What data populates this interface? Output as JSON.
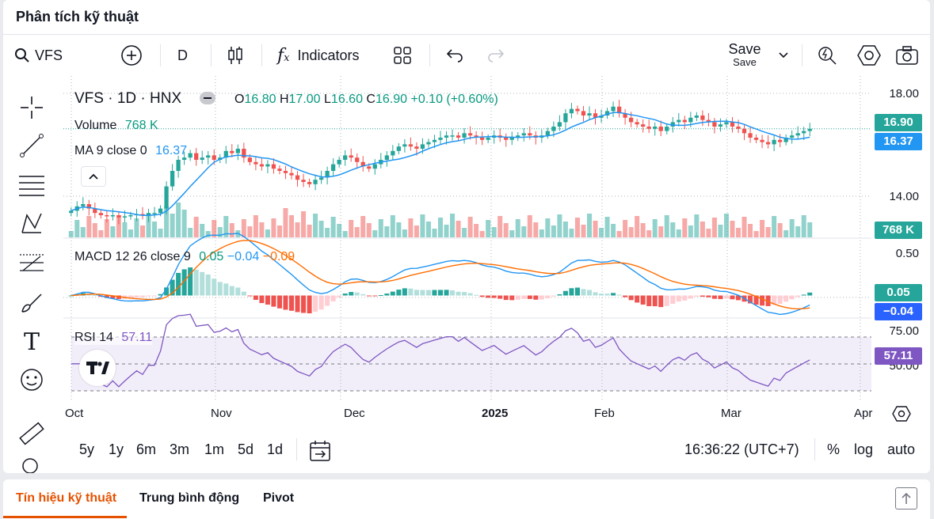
{
  "header": {
    "title": "Phân tích kỹ thuật"
  },
  "toolbar": {
    "symbol": "VFS",
    "interval": "D",
    "indicators_label": "Indicators",
    "save_label": "Save",
    "save_sub_label": "Save"
  },
  "legend": {
    "symbol_line": "VFS · 1D · HNX",
    "open_prefix": "O",
    "open": "16.80",
    "high_prefix": "H",
    "high": "17.00",
    "low_prefix": "L",
    "low": "16.60",
    "close_prefix": "C",
    "close": "16.90",
    "change": "+0.10 (+0.60%)",
    "volume_label": "Volume",
    "volume_value": "768 K",
    "ma_label": "MA 9 close 0",
    "ma_value": "16.37",
    "macd_label": "MACD 12 26 close 9",
    "macd_value1": "0.05",
    "macd_value2": "−0.04",
    "macd_value3": "−0.09",
    "rsi_label": "RSI 14",
    "rsi_value": "57.11"
  },
  "price_axis": {
    "ticks": [
      "18.00",
      "14.00"
    ],
    "last_price": "16.90",
    "ma_value": "16.37",
    "volume_value": "768 K",
    "macd_ticks": [
      "0.50"
    ],
    "macd_hist_value": "0.05",
    "macd_signal_value": "−0.04",
    "rsi_ticks": [
      "75.00",
      "50.00"
    ],
    "rsi_value": "57.11"
  },
  "time_axis": {
    "labels": [
      "Oct",
      "Nov",
      "Dec",
      "2025",
      "Feb",
      "Mar",
      "Apr"
    ]
  },
  "range_bar": {
    "ranges": [
      "5y",
      "1y",
      "6m",
      "3m",
      "1m",
      "5d",
      "1d"
    ],
    "clock": "16:36:22 (UTC+7)",
    "percent": "%",
    "log": "log",
    "auto": "auto"
  },
  "tabs": [
    "Tín hiệu kỹ thuật",
    "Trung bình động",
    "Pivot"
  ],
  "colors": {
    "up": "#26a69a",
    "down": "#ef5350",
    "ma": "#2196f3",
    "macd": "#2962ff",
    "signal": "#ff6d00",
    "rsi": "#7e57c2"
  },
  "chart_data": {
    "type": "candlestick",
    "y_range_price": [
      12.5,
      18.5
    ],
    "close": [
      13.2,
      13.4,
      13.5,
      13.3,
      13.1,
      13.0,
      12.95,
      13.0,
      12.9,
      12.95,
      13.0,
      13.05,
      13.0,
      13.1,
      13.1,
      13.3,
      14.3,
      15.0,
      15.5,
      15.6,
      15.8,
      15.5,
      15.6,
      15.7,
      15.5,
      15.6,
      15.9,
      15.8,
      16.0,
      15.6,
      15.4,
      15.3,
      15.2,
      15.3,
      15.1,
      15.0,
      14.9,
      14.8,
      14.6,
      14.5,
      14.4,
      14.6,
      14.7,
      15.0,
      15.3,
      15.5,
      15.7,
      15.6,
      15.4,
      15.2,
      15.1,
      15.3,
      15.5,
      15.7,
      15.9,
      16.1,
      16.2,
      16.1,
      16.0,
      16.2,
      16.3,
      16.4,
      16.5,
      16.6,
      16.6,
      16.5,
      16.7,
      16.6,
      16.5,
      16.4,
      16.5,
      16.6,
      16.5,
      16.4,
      16.5,
      16.6,
      16.7,
      16.6,
      16.5,
      16.6,
      16.8,
      17.0,
      17.2,
      17.6,
      17.8,
      17.7,
      17.5,
      17.6,
      17.4,
      17.5,
      17.7,
      17.9,
      17.6,
      17.4,
      17.2,
      17.1,
      17.0,
      16.9,
      17.0,
      16.8,
      17.0,
      17.2,
      17.3,
      17.2,
      17.4,
      17.5,
      17.3,
      17.2,
      17.0,
      17.1,
      17.2,
      17.0,
      16.9,
      16.7,
      16.5,
      16.4,
      16.3,
      16.2,
      16.4,
      16.3,
      16.5,
      16.6,
      16.7,
      16.8,
      16.9
    ],
    "volume_scale_note": "",
    "rsi_range": [
      25,
      80
    ],
    "macd_range": [
      -0.2,
      0.6
    ]
  }
}
